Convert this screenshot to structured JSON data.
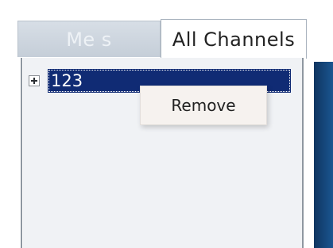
{
  "tabs": [
    {
      "label": "Me  s",
      "active": false
    },
    {
      "label": "All Channels",
      "active": true
    }
  ],
  "tree": {
    "selected_item": "123",
    "expander_icon": "plus-box-icon"
  },
  "context_menu": {
    "items": [
      {
        "label": "Remove"
      }
    ]
  },
  "colors": {
    "selection": "#102b74",
    "panel_bg": "#f0f2f5",
    "right_edge": "#1a5590"
  }
}
